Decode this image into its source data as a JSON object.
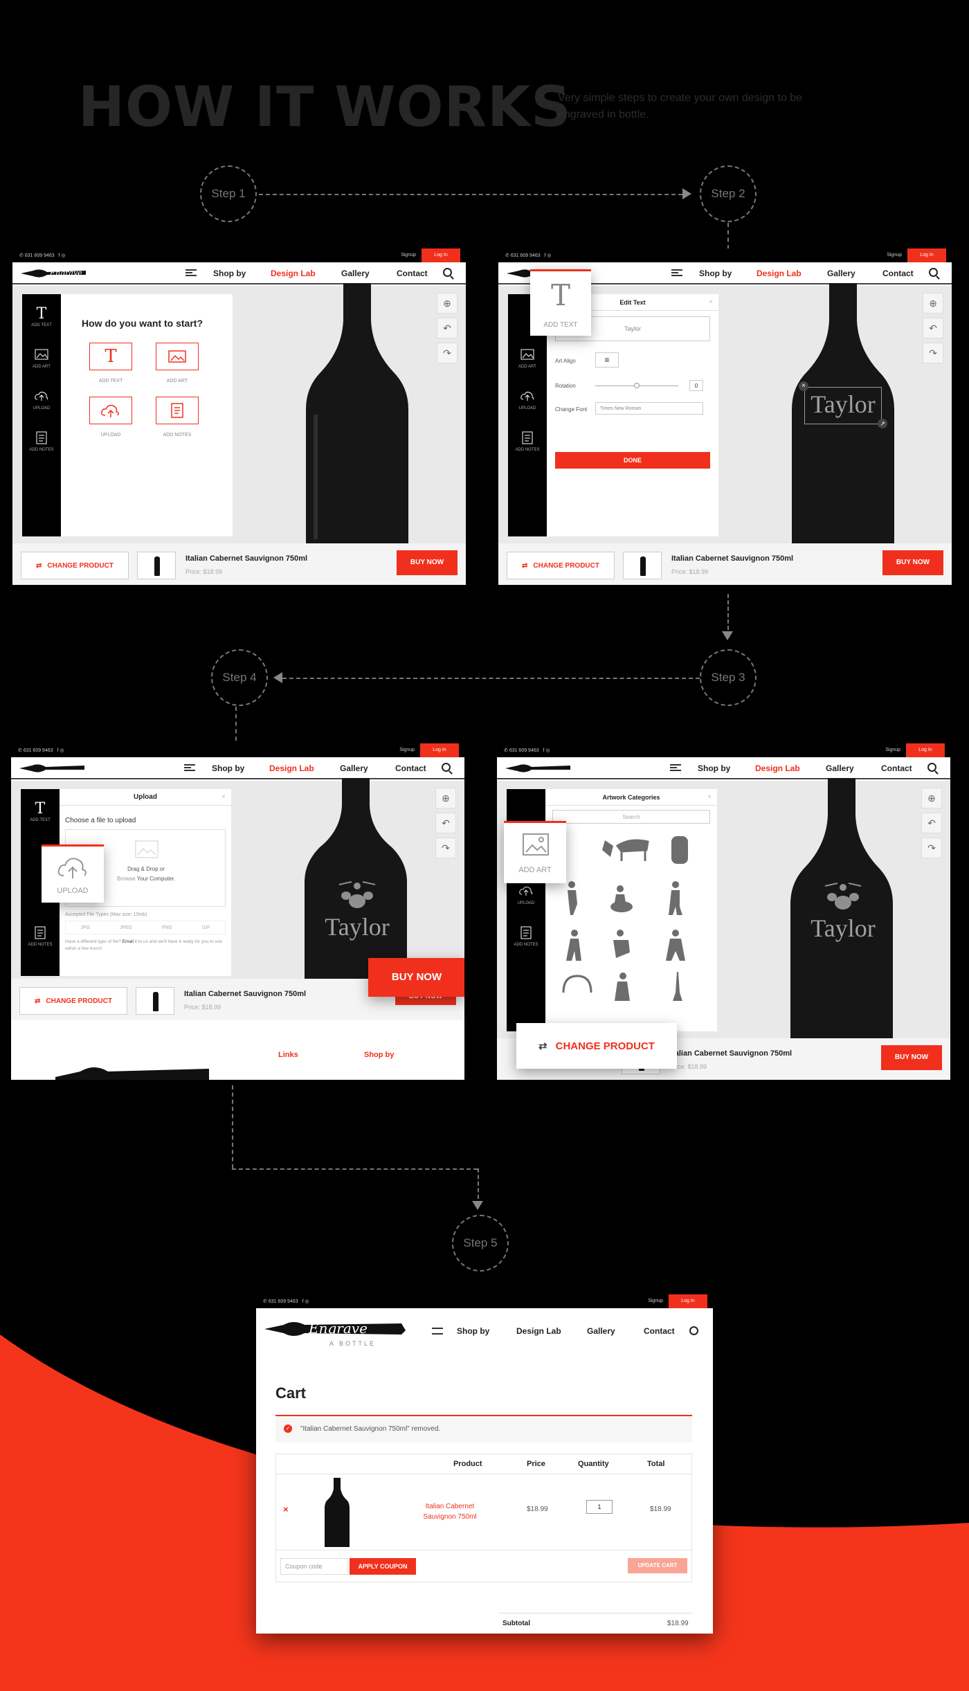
{
  "heading": {
    "title": "HOW IT WORKS",
    "subtitle": "Very simple steps to create your own design to be engraved in bottle."
  },
  "steps": [
    "Step 1",
    "Step 2",
    "Step 3",
    "Step 4",
    "Step 5"
  ],
  "topbar": {
    "phone": "631 609 9463",
    "signup": "Signup",
    "login": "Log In"
  },
  "nav": {
    "shop": "Shop by",
    "lab": "Design Lab",
    "gallery": "Gallery",
    "contact": "Contact"
  },
  "sidebar": {
    "add_text": "ADD TEXT",
    "add_art": "ADD ART",
    "upload": "UPLOAD",
    "add_notes": "ADD NOTES"
  },
  "product": {
    "change": "CHANGE PRODUCT",
    "name": "Italian Cabernet Sauvignon 750ml",
    "price": "Price: $18.99",
    "buy": "BUY NOW"
  },
  "screen1": {
    "question": "How do you want to start?",
    "options": [
      "ADD TEXT",
      "ADD ART",
      "UPLOAD",
      "ADD NOTES"
    ]
  },
  "screen2": {
    "panel_title": "Edit Text",
    "text_value": "Taylor",
    "art_align": "Art Align",
    "rotation": "Rotation",
    "rotation_value": "0",
    "change_font": "Change Font",
    "font_value": "Times New Roman",
    "done": "DONE",
    "engraving": "Taylor",
    "popout": "ADD TEXT"
  },
  "screen3": {
    "panel_title": "Upload",
    "choose": "Choose a file to upload",
    "drag": "Drag & Drop or",
    "browse": "Browse",
    "browse_rest": "Your Computer.",
    "accepted": "Accepted File Types (Max size: 10mb)",
    "types": [
      "JPG",
      "JPEG",
      "PNG",
      "GIF"
    ],
    "note": "Have a different type of file?",
    "note_email": "Email",
    "note_rest": "it to us and we'll have it ready for you to use within a few hours!",
    "popout": "UPLOAD",
    "buy_large": "BUY NOW",
    "footer_links": "Links",
    "footer_shop": "Shop by"
  },
  "screen4": {
    "panel_title": "Artwork Categories",
    "search": "Search",
    "popout": "ADD ART",
    "change_large": "CHANGE PRODUCT"
  },
  "cart": {
    "title": "Cart",
    "notice": "\"Italian Cabernet Sauvignon 750ml\" removed.",
    "headers": [
      "Product",
      "Price",
      "Quantity",
      "Total"
    ],
    "row": {
      "name": "Italian Cabernet Sauvignon 750ml",
      "price": "$18.99",
      "qty": "1",
      "total": "$18.99"
    },
    "coupon_placeholder": "Coupon code",
    "apply": "APPLY COUPON",
    "update": "UPDATE CART",
    "subtotal_label": "Subtotal",
    "subtotal": "$18.99",
    "logo_sub": "A BOTTLE"
  },
  "colors": {
    "accent": "#f0301c",
    "background": "#000000"
  }
}
